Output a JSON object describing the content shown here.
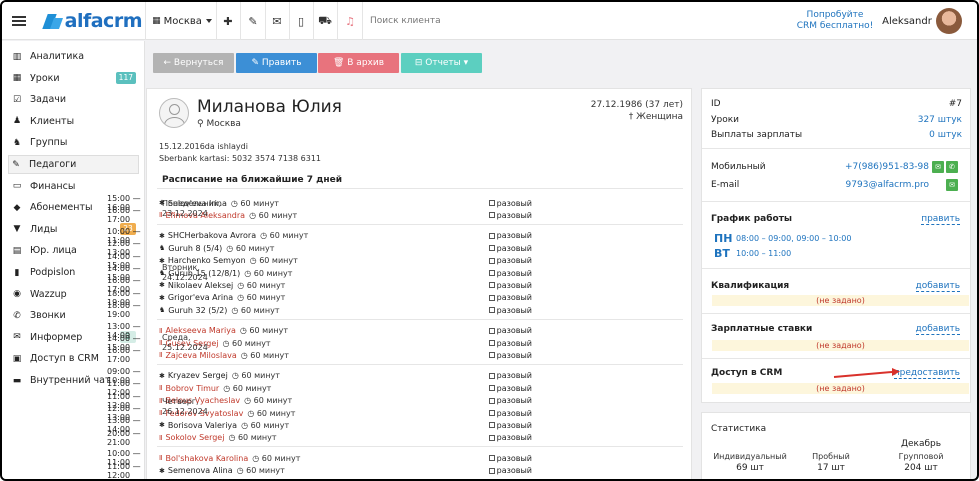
{
  "topbar": {
    "logo_text": "alfacrm",
    "city": "Москва",
    "search_placeholder": "Поиск клиента",
    "promo_line1": "Попробуйте",
    "promo_line2": "CRM бесплатно!",
    "user_name": "Aleksandr"
  },
  "sidebar": {
    "items": [
      {
        "label": "Аналитика",
        "icon": "chart-icon"
      },
      {
        "label": "Уроки",
        "icon": "calendar-icon",
        "badge": "117",
        "badge_color": "#5bc0be"
      },
      {
        "label": "Задачи",
        "icon": "tasks-icon"
      },
      {
        "label": "Клиенты",
        "icon": "user-icon"
      },
      {
        "label": "Группы",
        "icon": "users-icon"
      },
      {
        "label": "Педагоги",
        "icon": "teacher-icon"
      },
      {
        "label": "Финансы",
        "icon": "money-icon"
      },
      {
        "label": "Абонементы",
        "icon": "tag-icon"
      },
      {
        "label": "Лиды",
        "icon": "funnel-icon",
        "badge": "23",
        "badge_color": "#f0ad4e"
      },
      {
        "label": "Юр. лица",
        "icon": "building-icon"
      },
      {
        "label": "Podpislon",
        "icon": "document-icon"
      },
      {
        "label": "Wazzup",
        "icon": "chat-icon"
      },
      {
        "label": "Звонки",
        "icon": "phone-icon"
      },
      {
        "label": "Информер",
        "icon": "envelope-icon",
        "badge": "3",
        "badge_color": "#d5ede6"
      },
      {
        "label": "Доступ в CRM",
        "icon": "lock-icon"
      },
      {
        "label": "Внутренний чат",
        "icon": "comments-icon"
      }
    ]
  },
  "toolbar": {
    "back": "← Вернуться",
    "edit": "✎ Править",
    "archive": "🗑 В архив",
    "reports": "⊟ Отчеты ▾",
    "colors": {
      "back": "#b3b3b3",
      "edit": "#3c8fd6",
      "archive": "#e8737d",
      "reports": "#5ccfc0"
    }
  },
  "profile": {
    "name": "Миланова Юлия",
    "city": "Москва",
    "birth": "27.12.1986 (37 лет)",
    "gender": "Женщина",
    "note1": "15.12.2016da ishlaydi",
    "note2": "Sberbank kartasi: 5032 3574 7138 6311"
  },
  "schedule": {
    "title": "Расписание на ближайшие 7 дней",
    "duration": "60 минут",
    "once": "разовый",
    "days": [
      {
        "day": "Понедельник,",
        "date": "23.12.2024",
        "rows": [
          {
            "time": "15:00 — 16:00",
            "who": "Solov'eva Irina",
            "red": false,
            "type": "ind"
          },
          {
            "time": "16:00 — 17:00",
            "who": "Efimova Aleksandra",
            "red": true,
            "type": "ind"
          }
        ]
      },
      {
        "day": "Вторник,",
        "date": "24.12.2024",
        "rows": [
          {
            "time": "10:00 — 11:00",
            "who": "SHCHerbakova Avrora",
            "red": false,
            "type": "ind"
          },
          {
            "time": "12:00 — 13:00",
            "who": "Guruh 8 (5/4)",
            "red": false,
            "type": "grp"
          },
          {
            "time": "14:00 — 15:00",
            "who": "Harchenko Semyon",
            "red": false,
            "type": "ind"
          },
          {
            "time": "14:00 — 15:00",
            "who": "Guruh 15 (12/8/1)",
            "red": false,
            "type": "grp"
          },
          {
            "time": "16:00 — 17:00",
            "who": "Nikolaev Aleksej",
            "red": false,
            "type": "ind"
          },
          {
            "time": "18:00 — 19:00",
            "who": "Grigor'eva Arina",
            "red": false,
            "type": "ind"
          },
          {
            "time": "18:00 — 19:00",
            "who": "Guruh 32 (5/2)",
            "red": false,
            "type": "grp"
          }
        ]
      },
      {
        "day": "Среда,",
        "date": "25.12.2024",
        "rows": [
          {
            "time": "13:00 — 14:00",
            "who": "Alekseeva Mariya",
            "red": true,
            "type": "ind"
          },
          {
            "time": "14:00 — 15:00",
            "who": "Gusev Sergej",
            "red": true,
            "type": "ind"
          },
          {
            "time": "16:00 — 17:00",
            "who": "Zajceva Miloslava",
            "red": true,
            "type": "ind"
          }
        ]
      },
      {
        "day": "Четверг,",
        "date": "26.12.2024",
        "rows": [
          {
            "time": "09:00 — 10:00",
            "who": "Kryazev Sergej",
            "red": false,
            "type": "ind"
          },
          {
            "time": "11:00 — 12:00",
            "who": "Bobrov Timur",
            "red": true,
            "type": "ind"
          },
          {
            "time": "11:00 — 12:00",
            "who": "Belous Vyacheslav",
            "red": true,
            "type": "ind"
          },
          {
            "time": "12:00 — 13:00",
            "who": "Fedorov Svyatoslav",
            "red": true,
            "type": "ind"
          },
          {
            "time": "13:00 — 14:00",
            "who": "Borisova Valeriya",
            "red": false,
            "type": "ind"
          },
          {
            "time": "20:00 — 21:00",
            "who": "Sokolov Sergej",
            "red": true,
            "type": "ind"
          }
        ]
      },
      {
        "day": "",
        "date": "",
        "rows": [
          {
            "time": "10:00 — 11:00",
            "who": "Bol'shakova Karolina",
            "red": true,
            "type": "ind"
          },
          {
            "time": "11:00 — 12:00",
            "who": "Semenova Alina",
            "red": false,
            "type": "ind"
          }
        ]
      }
    ]
  },
  "right": {
    "id_label": "ID",
    "id_value": "#7",
    "lessons_label": "Уроки",
    "lessons_value": "327 штук",
    "salary_label": "Выплаты зарплаты",
    "salary_value": "0 штук",
    "mobile_label": "Мобильный",
    "mobile_value": "+7(986)951-83-98",
    "email_label": "E-mail",
    "email_value": "9793@alfacrm.pro",
    "schedule_label": "График работы",
    "schedule_link": "править",
    "mon": "ПН",
    "mon_hours": "08:00 – 09:00, 09:00 – 10:00",
    "tue": "ВТ",
    "tue_hours": "10:00 – 11:00",
    "qual_label": "Квалификация",
    "add": "добавить",
    "not_set": "(не задано)",
    "rates_label": "Зарплатные ставки",
    "access_label": "Доступ в CRM",
    "access_link": "предоставить"
  },
  "stats": {
    "title": "Статистика",
    "month": "Декабрь",
    "items": [
      {
        "label": "Индивидуальный",
        "value": "69 шт"
      },
      {
        "label": "Пробный",
        "value": "17 шт"
      },
      {
        "label": "Групповой",
        "value": "204 шт"
      }
    ]
  }
}
